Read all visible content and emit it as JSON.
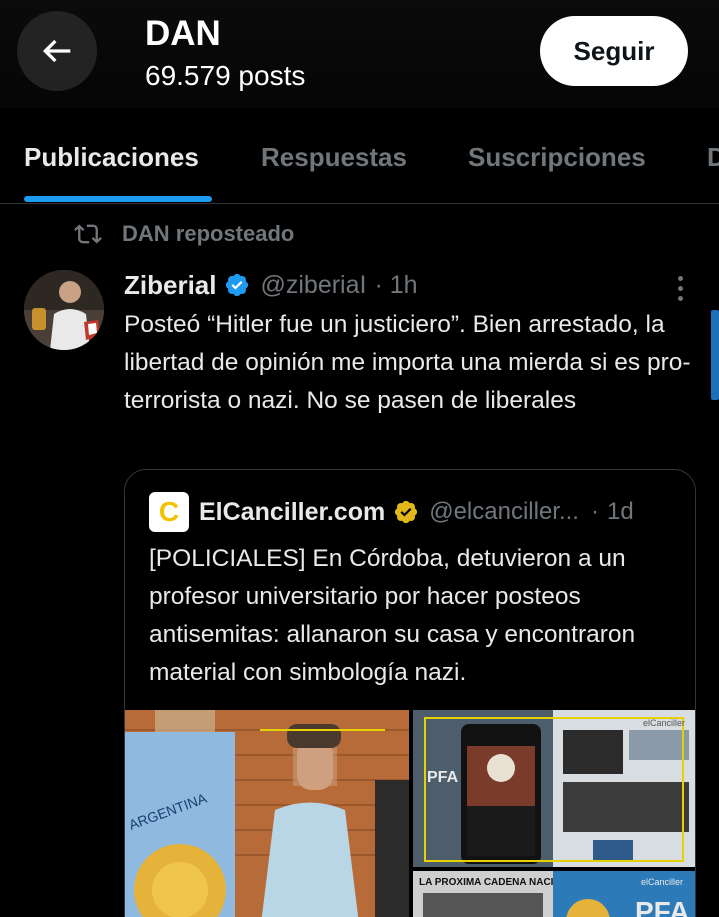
{
  "header": {
    "name": "DAN",
    "posts": "69.579 posts",
    "follow_label": "Seguir"
  },
  "tabs": [
    {
      "label": "Publicaciones",
      "active": true
    },
    {
      "label": "Respuestas",
      "active": false
    },
    {
      "label": "Suscripciones",
      "active": false
    },
    {
      "label": "D",
      "active": false
    }
  ],
  "repost": {
    "label": "DAN reposteado"
  },
  "tweet": {
    "author": "Ziberial",
    "handle": "@ziberiaI",
    "time": "· 1h",
    "text": "Posteó “Hitler fue un justiciero”. Bien arrestado, la libertad de opinión me importa una mierda si es pro-terrorista o nazi. No se pasen de liberales"
  },
  "quote": {
    "logo_letter": "C",
    "name": "ElCanciller.com",
    "handle": "@elcanciller...",
    "time": "1d",
    "text": "[POLICIALES] En Córdoba, detuvieron a un profesor universitario por hacer posteos antisemitas: allanaron su casa y encontraron material con simbología nazi.",
    "image_labels": {
      "country": "ARGENTINA",
      "pfa": "PFA",
      "watermark": "elCanciller",
      "headline_bottom": "LA PROXIMA CADENA NACIONAL"
    }
  },
  "colors": {
    "accent": "#1d9bf0",
    "verified_blue": "#1d9bf0",
    "verified_gold": "#e2b719",
    "muted": "#71767b"
  }
}
